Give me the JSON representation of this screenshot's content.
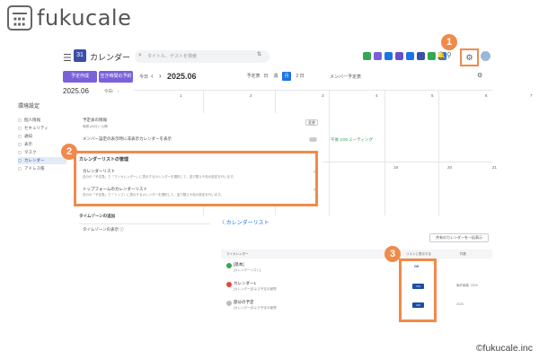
{
  "brand": {
    "logo_text": "fukucale"
  },
  "topbar": {
    "app_title": "カレンダー",
    "search_placeholder": "タイトル、ゲストを検索",
    "app_icons": [
      "#34a853",
      "#7b61d9",
      "#1a73e8",
      "#6a4fc8",
      "#1a73e8",
      "#3b4fa8",
      "#34a853",
      "#1a73e8"
    ]
  },
  "callouts": [
    "1",
    "2",
    "3"
  ],
  "toolbar": {
    "primary_button": "予定作成",
    "secondary_button": "空き時間の予約",
    "today": "今日",
    "current_date": "2025.06",
    "view_options": [
      "予定表",
      "日",
      "週",
      "月"
    ],
    "active_view": "月",
    "more_view": "2 日",
    "member_label": "メンバー予定表"
  },
  "mini_calendar": {
    "month": "2025.06",
    "nav_today": "今日"
  },
  "sidebar": {
    "title": "環境設定",
    "items": [
      "個人情報",
      "セキュリティ",
      "通知",
      "表示",
      "タスク",
      "カレンダー",
      "アドレス帳"
    ],
    "active_index": 5
  },
  "calendar_grid": {
    "week1": [
      "1",
      "2",
      "3",
      "4",
      "5",
      "6",
      "7"
    ],
    "week2": [
      "15",
      "16",
      "17",
      "18",
      "19",
      "20",
      "21"
    ],
    "event_text": "午後 3:00 ミーティング"
  },
  "settings": {
    "default_schedule_label": "予定表の情報",
    "default_schedule_value": "時間 (30分) / 公開",
    "edit_button": "変更",
    "member_toggle_label": "メンバー設定の表示時に非表示カレンダーを表示",
    "manage_title": "カレンダーリストの管理",
    "rows": [
      {
        "title": "カレンダーリスト",
        "sub": "自分の「予定表」で「マイカレンダー」に表示するカレンダーを選択して、並び替えや色の設定を行います。"
      },
      {
        "title": "トップフォームのカレンダーリスト",
        "sub": "自分の「予定表」で「トップ」に表示するカレンダーを選択して、並び替えや色の設定を行います。"
      }
    ],
    "timezone_title": "タイムゾーンの追加",
    "timezone_label": "タイムゾーンの表示 ⓘ"
  },
  "calendar_list": {
    "back_title": "〈 カレンダーリスト",
    "add_button": "共有のカレンダーを一括表示",
    "headers": [
      "マイカレンダー",
      "リストに表示する",
      "件数"
    ],
    "rows": [
      {
        "title": "[基本]",
        "sub": "[カレンダーリスト]",
        "color": "#34a853",
        "toggle": "OK",
        "meta": ""
      },
      {
        "title": "カレンダー1",
        "sub": "[カレンダー]および予定の管理",
        "color": "#e8453c",
        "toggle": "ON",
        "meta": "最終編集: 2025"
      },
      {
        "title": "部分の予定",
        "sub": "[カレンダー]および予定の管理",
        "color": "#bbbbbb",
        "toggle": "ON",
        "meta": "2025"
      }
    ]
  },
  "copyright": "©fukucale.inc"
}
